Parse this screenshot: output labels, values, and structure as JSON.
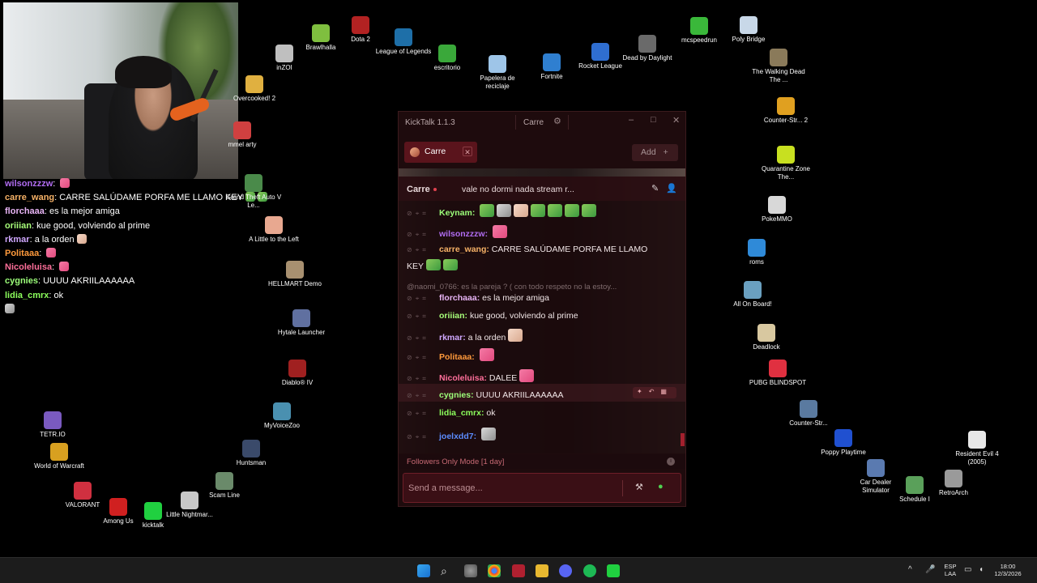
{
  "webcam": {
    "alt": "Streamer webcam"
  },
  "overlay_chat": [
    {
      "user": "wilsonzzzw",
      "color": "#b06cf0",
      "text": "",
      "emotes": [
        "pink"
      ]
    },
    {
      "user": "carre_wang",
      "color": "#f7b267",
      "text": "CARRE SALÚDAME PORFA ME LLAMO KEY",
      "emotes": [
        "green",
        "green"
      ]
    },
    {
      "user": "florchaaa",
      "color": "#e8b4f5",
      "text": "es la mejor amiga",
      "emotes": []
    },
    {
      "user": "oriiian",
      "color": "#a8ff7a",
      "text": "kue good, volviendo al prime",
      "emotes": []
    },
    {
      "user": "rkmar",
      "color": "#d0a8ff",
      "text": "a la orden",
      "emotes": [
        "hand"
      ]
    },
    {
      "user": "Politaaa",
      "color": "#ff9a3c",
      "text": "",
      "emotes": [
        "pink"
      ]
    },
    {
      "user": "Nicoleluisa",
      "color": "#ff6f9a",
      "text": "",
      "emotes": [
        "pink"
      ]
    },
    {
      "user": "cygnies",
      "color": "#9dff7a",
      "text": "UUUU AKRIILAAAAAA",
      "emotes": []
    },
    {
      "user": "lidia_cmrx",
      "color": "#8cff5c",
      "text": "ok",
      "emotes": []
    }
  ],
  "desktop_icons": [
    {
      "label": "Brawlhalla",
      "color": "#7fbf3f"
    },
    {
      "label": "Dota 2",
      "color": "#b22222"
    },
    {
      "label": "inZOI",
      "color": "#bfbfbf"
    },
    {
      "label": "League of Legends",
      "color": "#1e6fa8"
    },
    {
      "label": "escritorio",
      "color": "#3aa83a"
    },
    {
      "label": "Papelera de reciclaje",
      "color": "#9ec5e8"
    },
    {
      "label": "Fortnite",
      "color": "#2f7fd0"
    },
    {
      "label": "Rocket League",
      "color": "#2f6ed0"
    },
    {
      "label": "Dead by Daylight",
      "color": "#6a6a6a"
    },
    {
      "label": "mcspeedrun",
      "color": "#3ab83a"
    },
    {
      "label": "Poly Bridge",
      "color": "#c8d8e8"
    },
    {
      "label": "Overcooked! 2",
      "color": "#e0b040"
    },
    {
      "label": "The Walking Dead The ...",
      "color": "#8a7a5a"
    },
    {
      "label": "mmel arty",
      "color": "#d04040"
    },
    {
      "label": "Counter-Str... 2",
      "color": "#e0a020"
    },
    {
      "label": "Grand Theft Auto V Le...",
      "color": "#4a8a4a"
    },
    {
      "label": "Quarantine Zone The...",
      "color": "#c8e020"
    },
    {
      "label": "A Little to the Left",
      "color": "#e8a890"
    },
    {
      "label": "PokeMMO",
      "color": "#d8d8d8"
    },
    {
      "label": "HELLMART Demo",
      "color": "#a89070"
    },
    {
      "label": "roms",
      "color": "#2f8ad8"
    },
    {
      "label": "All On Board!",
      "color": "#6aa0c0"
    },
    {
      "label": "Hytale Launcher",
      "color": "#6070a0"
    },
    {
      "label": "Deadlock",
      "color": "#d8c8a0"
    },
    {
      "label": "Diablo® IV",
      "color": "#a02020"
    },
    {
      "label": "PUBG BLINDSPOT",
      "color": "#e03040"
    },
    {
      "label": "MyVoiceZoo",
      "color": "#4a90b0"
    },
    {
      "label": "Counter-Str...",
      "color": "#5a7aa0"
    },
    {
      "label": "TETR.IO",
      "color": "#7a5ac0"
    },
    {
      "label": "Huntsman",
      "color": "#3a4a6a"
    },
    {
      "label": "Poppy Playtime",
      "color": "#2050d0"
    },
    {
      "label": "Resident Evil 4 (2005)",
      "color": "#e8e8e8"
    },
    {
      "label": "World of Warcraft",
      "color": "#d8a020"
    },
    {
      "label": "Scam Line",
      "color": "#6a8a6a"
    },
    {
      "label": "Car Dealer Simulator",
      "color": "#5a7ab0"
    },
    {
      "label": "RetroArch",
      "color": "#9a9a9a"
    },
    {
      "label": "Schedule I",
      "color": "#5aa05a"
    },
    {
      "label": "VALORANT",
      "color": "#d03040"
    },
    {
      "label": "Among Us",
      "color": "#d02020"
    },
    {
      "label": "kicktalk",
      "color": "#20d040"
    },
    {
      "label": "Little Nightmar...",
      "color": "#c8c8c8"
    }
  ],
  "kicktalk": {
    "title": "KickTalk 1.1.3",
    "account": "Carre",
    "tab_label": "Carre",
    "add_label": "Add",
    "channel": "Carre",
    "pinned_topic": "vale  no dormi nada  stream r...",
    "reply_preview": "@naomi_0766: es la pareja ? ( con todo respeto no la estoy...",
    "messages": [
      {
        "user": "Keynam",
        "color": "#9dff7a",
        "text": ""
      },
      {
        "user": "wilsonzzzw",
        "color": "#b06cf0",
        "text": ""
      },
      {
        "user": "carre_wang",
        "color": "#f7b267",
        "text": "CARRE SALÚDAME PORFA ME LLAMO",
        "cont": "KEY"
      },
      {
        "user": "florchaaa",
        "color": "#e8b4f5",
        "text": "es la mejor amiga"
      },
      {
        "user": "oriiian",
        "color": "#a8ff7a",
        "text": "kue good, volviendo al prime"
      },
      {
        "user": "rkmar",
        "color": "#d0a8ff",
        "text": "a la orden"
      },
      {
        "user": "Politaaa",
        "color": "#ff9a3c",
        "text": ""
      },
      {
        "user": "Nicoleluisa",
        "color": "#ff6f9a",
        "text": "DALEE"
      },
      {
        "user": "cygnies",
        "color": "#9dff7a",
        "text": "UUUU AKRIILAAAAAA"
      },
      {
        "user": "lidia_cmrx",
        "color": "#8cff5c",
        "text": "ok"
      },
      {
        "user": "joelxdd7",
        "color": "#5c8cff",
        "text": ""
      }
    ],
    "status_text": "Followers Only Mode [1 day]",
    "input_placeholder": "Send a message..."
  },
  "taskbar": {
    "lang_top": "ESP",
    "lang_bottom": "LAA",
    "time": "18:00",
    "date": "12/3/2026"
  }
}
